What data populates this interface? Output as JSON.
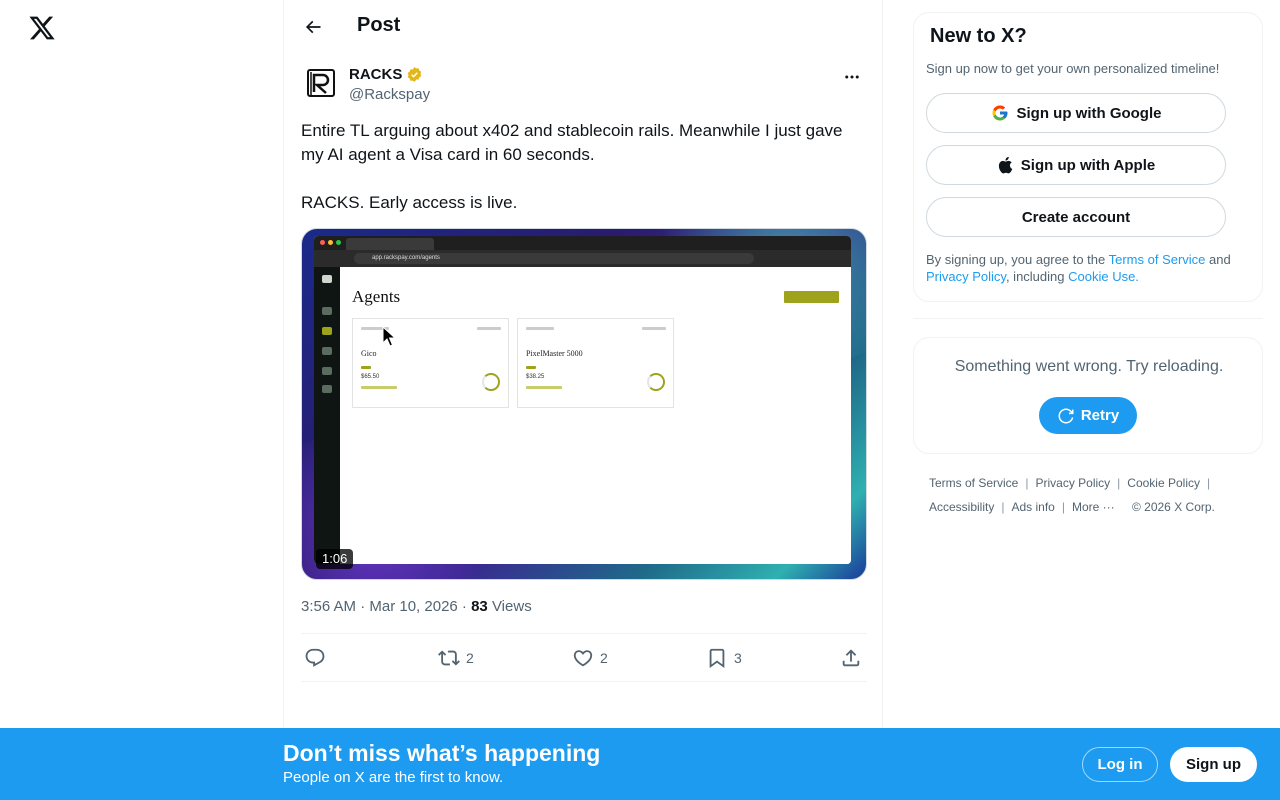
{
  "header": {
    "title": "Post"
  },
  "post": {
    "author_name": "RACKS",
    "author_handle": "@Rackspay",
    "text_line1": "Entire TL arguing about x402 and stablecoin rails. Meanwhile I just gave my AI agent a Visa card in 60 seconds.",
    "text_line2": "RACKS. Early access is live.",
    "video_duration": "1:06",
    "timestamp": "3:56 AM · Mar 10, 2026 · ",
    "views_count": "83",
    "views_label": " Views",
    "reposts": "2",
    "likes": "2",
    "bookmarks": "3"
  },
  "media_screen": {
    "page_title": "Agents",
    "address": "app.rackspay.com/agents",
    "agent_1": "Gico",
    "agent_2": "PixelMaster 5000",
    "amount_1": "$65.50",
    "amount_2": "$38.25"
  },
  "sidebar": {
    "new_title": "New to X?",
    "new_sub": "Sign up now to get your own personalized timeline!",
    "google_btn": "Sign up with Google",
    "apple_btn": "Sign up with Apple",
    "create_btn": "Create account",
    "terms_pre": "By signing up, you agree to the ",
    "terms_tos": "Terms of Service",
    "terms_and": " and ",
    "terms_privacy": "Privacy Policy",
    "terms_including": ", including ",
    "terms_cookie": "Cookie Use.",
    "error_text": "Something went wrong. Try reloading.",
    "retry_btn": "Retry"
  },
  "footer": {
    "tos": "Terms of Service",
    "privacy": "Privacy Policy",
    "cookie": "Cookie Policy",
    "accessibility": "Accessibility",
    "ads": "Ads info",
    "more": "More ···",
    "copyright": "© 2026 X Corp."
  },
  "banner": {
    "title": "Don’t miss what’s happening",
    "sub": "People on X are the first to know.",
    "login": "Log in",
    "signup": "Sign up"
  },
  "colors": {
    "accent": "#1d9bf0",
    "text": "#0f1419",
    "muted": "#536471",
    "verified": "#e2b719"
  }
}
